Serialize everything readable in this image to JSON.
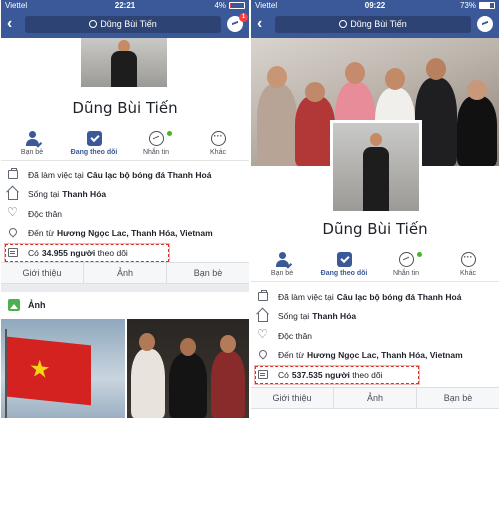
{
  "left": {
    "status": {
      "carrier": "Viettel",
      "time": "22:21",
      "battery": "4%",
      "battery_level": 0.04
    },
    "search_text": "Dũng Bùi Tiến",
    "messenger_badge": "1",
    "name": "Dũng Bùi Tiến",
    "actions": [
      {
        "label": "Bạn bè",
        "icon": "friends-check-icon"
      },
      {
        "label": "Đang theo dõi",
        "icon": "following-icon"
      },
      {
        "label": "Nhắn tin",
        "icon": "messenger-icon"
      },
      {
        "label": "Khác",
        "icon": "more-icon"
      }
    ],
    "info": {
      "work_prefix": "Đã làm việc tại",
      "work_place": "Câu lạc bộ bóng đá Thanh Hoá",
      "lives_prefix": "Sống tại",
      "lives_place": "Thanh Hóa",
      "relationship": "Độc thân",
      "from_prefix": "Đến từ",
      "from_place": "Hương Ngọc Lac, Thanh Hóa, Vietnam",
      "followers_prefix": "Có",
      "followers_count": "34.955 người",
      "followers_suffix": "theo dõi"
    },
    "tabs": [
      "Giới thiệu",
      "Ảnh",
      "Bạn bè"
    ],
    "photos_title": "Ảnh"
  },
  "right": {
    "status": {
      "carrier": "Viettel",
      "time": "09:22",
      "battery": "73%",
      "battery_level": 0.73
    },
    "search_text": "Dũng Bùi Tiến",
    "name": "Dũng Bùi Tiến",
    "actions": [
      {
        "label": "Bạn bè",
        "icon": "friends-check-icon"
      },
      {
        "label": "Đang theo dõi",
        "icon": "following-icon"
      },
      {
        "label": "Nhắn tin",
        "icon": "messenger-icon"
      },
      {
        "label": "Khác",
        "icon": "more-icon"
      }
    ],
    "info": {
      "work_prefix": "Đã làm việc tại",
      "work_place": "Câu lạc bộ bóng đá Thanh Hoá",
      "lives_prefix": "Sống tại",
      "lives_place": "Thanh Hóa",
      "relationship": "Độc thân",
      "from_prefix": "Đến từ",
      "from_place": "Hương Ngọc Lac, Thanh Hóa, Vietnam",
      "followers_prefix": "Có",
      "followers_count": "537.535 người",
      "followers_suffix": "theo dõi"
    },
    "tabs": [
      "Giới thiệu",
      "Ảnh",
      "Bạn bè"
    ]
  },
  "colors": {
    "facebook_blue": "#3b5998",
    "highlight_red": "#d93025",
    "online_green": "#42b72a"
  }
}
